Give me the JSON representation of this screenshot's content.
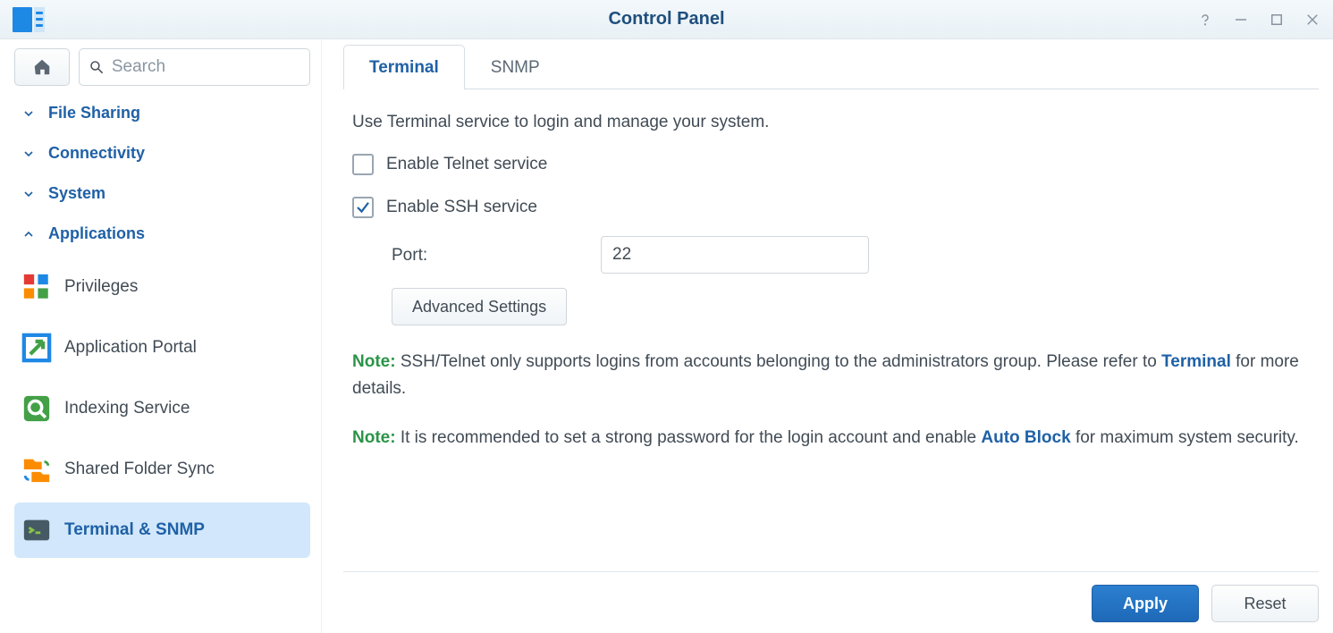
{
  "window": {
    "title": "Control Panel"
  },
  "search": {
    "placeholder": "Search"
  },
  "sidebar": {
    "categories": [
      {
        "label": "File Sharing",
        "expanded": false
      },
      {
        "label": "Connectivity",
        "expanded": false
      },
      {
        "label": "System",
        "expanded": false
      },
      {
        "label": "Applications",
        "expanded": true
      }
    ],
    "items": [
      {
        "label": "Privileges"
      },
      {
        "label": "Application Portal"
      },
      {
        "label": "Indexing Service"
      },
      {
        "label": "Shared Folder Sync"
      },
      {
        "label": "Terminal & SNMP"
      }
    ],
    "active_item": "Terminal & SNMP"
  },
  "tabs": [
    {
      "label": "Terminal",
      "active": true
    },
    {
      "label": "SNMP",
      "active": false
    }
  ],
  "content": {
    "intro": "Use Terminal service to login and manage your system.",
    "telnet": {
      "label": "Enable Telnet service",
      "checked": false
    },
    "ssh": {
      "label": "Enable SSH service",
      "checked": true
    },
    "port": {
      "label": "Port:",
      "value": "22"
    },
    "advanced_btn": "Advanced Settings",
    "note1": {
      "label": "Note:",
      "text_a": " SSH/Telnet only supports logins from accounts belonging to the administrators group. Please refer to ",
      "link": "Terminal",
      "text_b": " for more details."
    },
    "note2": {
      "label": "Note:",
      "text_a": " It is recommended to set a strong password for the login account and enable ",
      "link": "Auto Block",
      "text_b": " for maximum system security."
    }
  },
  "footer": {
    "apply": "Apply",
    "reset": "Reset"
  }
}
